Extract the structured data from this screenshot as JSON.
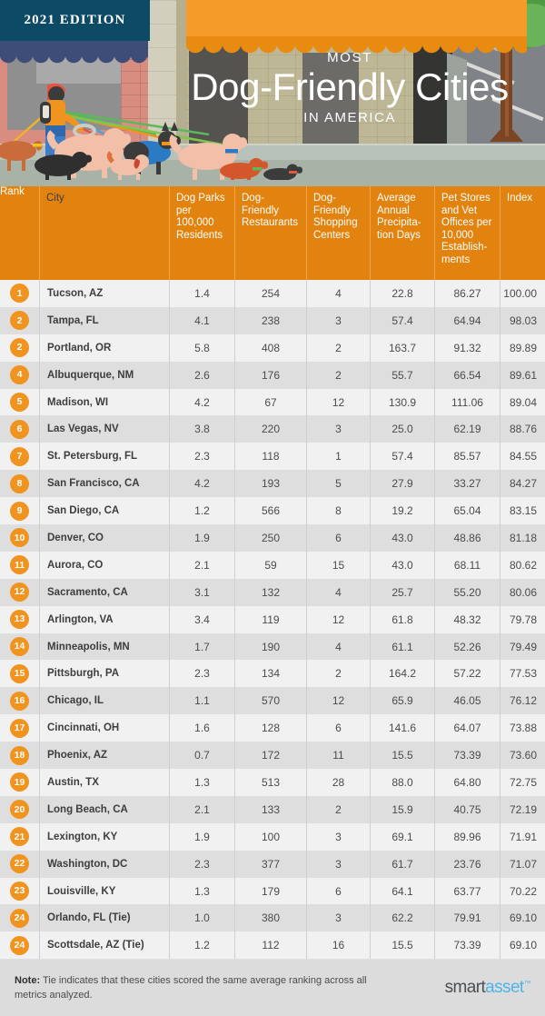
{
  "hero": {
    "edition_badge": "2021 EDITION",
    "superhead": "MOST",
    "title": "Dog-Friendly Cities",
    "subhead": "IN AMERICA",
    "illustration": "dog-walker-with-dogs-on-city-street"
  },
  "colors": {
    "header_orange": "#e2830f",
    "badge_orange": "#f0931f",
    "awning_orange": "#f59b28",
    "edition_navy": "#0d4a66",
    "row_odd": "#f1f1f1",
    "row_even": "#dedede",
    "footer_gray": "#dcdcdc",
    "logo_blue": "#4fb4e8",
    "text_gray": "#4b4b4b"
  },
  "table": {
    "columns": [
      "Rank",
      "City",
      "Dog Parks per 100,000 Residents",
      "Dog-Friendly Restaurants",
      "Dog-Friendly Shopping Centers",
      "Average Annual Precipita-tion Days",
      "Pet Stores and Vet Offices per 10,000 Establish-ments",
      "Index"
    ],
    "rows": [
      {
        "rank": "1",
        "city": "Tucson, AZ",
        "parks": "1.4",
        "restaurants": "254",
        "shopping": "4",
        "precip": "22.8",
        "pet_stores": "86.27",
        "index": "100.00"
      },
      {
        "rank": "2",
        "city": "Tampa, FL",
        "parks": "4.1",
        "restaurants": "238",
        "shopping": "3",
        "precip": "57.4",
        "pet_stores": "64.94",
        "index": "98.03"
      },
      {
        "rank": "2",
        "city": "Portland, OR",
        "parks": "5.8",
        "restaurants": "408",
        "shopping": "2",
        "precip": "163.7",
        "pet_stores": "91.32",
        "index": "89.89"
      },
      {
        "rank": "4",
        "city": "Albuquerque, NM",
        "parks": "2.6",
        "restaurants": "176",
        "shopping": "2",
        "precip": "55.7",
        "pet_stores": "66.54",
        "index": "89.61"
      },
      {
        "rank": "5",
        "city": "Madison, WI",
        "parks": "4.2",
        "restaurants": "67",
        "shopping": "12",
        "precip": "130.9",
        "pet_stores": "111.06",
        "index": "89.04"
      },
      {
        "rank": "6",
        "city": "Las Vegas, NV",
        "parks": "3.8",
        "restaurants": "220",
        "shopping": "3",
        "precip": "25.0",
        "pet_stores": "62.19",
        "index": "88.76"
      },
      {
        "rank": "7",
        "city": "St. Petersburg, FL",
        "parks": "2.3",
        "restaurants": "118",
        "shopping": "1",
        "precip": "57.4",
        "pet_stores": "85.57",
        "index": "84.55"
      },
      {
        "rank": "8",
        "city": "San Francisco, CA",
        "parks": "4.2",
        "restaurants": "193",
        "shopping": "5",
        "precip": "27.9",
        "pet_stores": "33.27",
        "index": "84.27"
      },
      {
        "rank": "9",
        "city": "San Diego, CA",
        "parks": "1.2",
        "restaurants": "566",
        "shopping": "8",
        "precip": "19.2",
        "pet_stores": "65.04",
        "index": "83.15"
      },
      {
        "rank": "10",
        "city": "Denver, CO",
        "parks": "1.9",
        "restaurants": "250",
        "shopping": "6",
        "precip": "43.0",
        "pet_stores": "48.86",
        "index": "81.18"
      },
      {
        "rank": "11",
        "city": "Aurora, CO",
        "parks": "2.1",
        "restaurants": "59",
        "shopping": "15",
        "precip": "43.0",
        "pet_stores": "68.11",
        "index": "80.62"
      },
      {
        "rank": "12",
        "city": "Sacramento, CA",
        "parks": "3.1",
        "restaurants": "132",
        "shopping": "4",
        "precip": "25.7",
        "pet_stores": "55.20",
        "index": "80.06"
      },
      {
        "rank": "13",
        "city": "Arlington, VA",
        "parks": "3.4",
        "restaurants": "119",
        "shopping": "12",
        "precip": "61.8",
        "pet_stores": "48.32",
        "index": "79.78"
      },
      {
        "rank": "14",
        "city": "Minneapolis, MN",
        "parks": "1.7",
        "restaurants": "190",
        "shopping": "4",
        "precip": "61.1",
        "pet_stores": "52.26",
        "index": "79.49"
      },
      {
        "rank": "15",
        "city": "Pittsburgh, PA",
        "parks": "2.3",
        "restaurants": "134",
        "shopping": "2",
        "precip": "164.2",
        "pet_stores": "57.22",
        "index": "77.53"
      },
      {
        "rank": "16",
        "city": "Chicago, IL",
        "parks": "1.1",
        "restaurants": "570",
        "shopping": "12",
        "precip": "65.9",
        "pet_stores": "46.05",
        "index": "76.12"
      },
      {
        "rank": "17",
        "city": "Cincinnati, OH",
        "parks": "1.6",
        "restaurants": "128",
        "shopping": "6",
        "precip": "141.6",
        "pet_stores": "64.07",
        "index": "73.88"
      },
      {
        "rank": "18",
        "city": "Phoenix, AZ",
        "parks": "0.7",
        "restaurants": "172",
        "shopping": "11",
        "precip": "15.5",
        "pet_stores": "73.39",
        "index": "73.60"
      },
      {
        "rank": "19",
        "city": "Austin, TX",
        "parks": "1.3",
        "restaurants": "513",
        "shopping": "28",
        "precip": "88.0",
        "pet_stores": "64.80",
        "index": "72.75"
      },
      {
        "rank": "20",
        "city": "Long Beach, CA",
        "parks": "2.1",
        "restaurants": "133",
        "shopping": "2",
        "precip": "15.9",
        "pet_stores": "40.75",
        "index": "72.19"
      },
      {
        "rank": "21",
        "city": "Lexington, KY",
        "parks": "1.9",
        "restaurants": "100",
        "shopping": "3",
        "precip": "69.1",
        "pet_stores": "89.96",
        "index": "71.91"
      },
      {
        "rank": "22",
        "city": "Washington, DC",
        "parks": "2.3",
        "restaurants": "377",
        "shopping": "3",
        "precip": "61.7",
        "pet_stores": "23.76",
        "index": "71.07"
      },
      {
        "rank": "23",
        "city": "Louisville, KY",
        "parks": "1.3",
        "restaurants": "179",
        "shopping": "6",
        "precip": "64.1",
        "pet_stores": "63.77",
        "index": "70.22"
      },
      {
        "rank": "24",
        "city": "Orlando, FL (Tie)",
        "parks": "1.0",
        "restaurants": "380",
        "shopping": "3",
        "precip": "62.2",
        "pet_stores": "79.91",
        "index": "69.10"
      },
      {
        "rank": "24",
        "city": "Scottsdale, AZ (Tie)",
        "parks": "1.2",
        "restaurants": "112",
        "shopping": "16",
        "precip": "15.5",
        "pet_stores": "73.39",
        "index": "69.10"
      }
    ]
  },
  "footer": {
    "note_label": "Note:",
    "note_text": " Tie indicates that these cities scored the same average ranking across all metrics analyzed.",
    "logo_first": "smart",
    "logo_second": "asset",
    "logo_tm": "™"
  },
  "chart_data": {
    "type": "table",
    "title": "Most Dog-Friendly Cities in America",
    "columns": [
      "Rank",
      "City",
      "Dog Parks per 100,000 Residents",
      "Dog-Friendly Restaurants",
      "Dog-Friendly Shopping Centers",
      "Average Annual Precipitation Days",
      "Pet Stores and Vet Offices per 10,000 Establishments",
      "Index"
    ],
    "rows": [
      [
        "1",
        "Tucson, AZ",
        1.4,
        254,
        4,
        22.8,
        86.27,
        100.0
      ],
      [
        "2",
        "Tampa, FL",
        4.1,
        238,
        3,
        57.4,
        64.94,
        98.03
      ],
      [
        "2",
        "Portland, OR",
        5.8,
        408,
        2,
        163.7,
        91.32,
        89.89
      ],
      [
        "4",
        "Albuquerque, NM",
        2.6,
        176,
        2,
        55.7,
        66.54,
        89.61
      ],
      [
        "5",
        "Madison, WI",
        4.2,
        67,
        12,
        130.9,
        111.06,
        89.04
      ],
      [
        "6",
        "Las Vegas, NV",
        3.8,
        220,
        3,
        25.0,
        62.19,
        88.76
      ],
      [
        "7",
        "St. Petersburg, FL",
        2.3,
        118,
        1,
        57.4,
        85.57,
        84.55
      ],
      [
        "8",
        "San Francisco, CA",
        4.2,
        193,
        5,
        27.9,
        33.27,
        84.27
      ],
      [
        "9",
        "San Diego, CA",
        1.2,
        566,
        8,
        19.2,
        65.04,
        83.15
      ],
      [
        "10",
        "Denver, CO",
        1.9,
        250,
        6,
        43.0,
        48.86,
        81.18
      ],
      [
        "11",
        "Aurora, CO",
        2.1,
        59,
        15,
        43.0,
        68.11,
        80.62
      ],
      [
        "12",
        "Sacramento, CA",
        3.1,
        132,
        4,
        25.7,
        55.2,
        80.06
      ],
      [
        "13",
        "Arlington, VA",
        3.4,
        119,
        12,
        61.8,
        48.32,
        79.78
      ],
      [
        "14",
        "Minneapolis, MN",
        1.7,
        190,
        4,
        61.1,
        52.26,
        79.49
      ],
      [
        "15",
        "Pittsburgh, PA",
        2.3,
        134,
        2,
        164.2,
        57.22,
        77.53
      ],
      [
        "16",
        "Chicago, IL",
        1.1,
        570,
        12,
        65.9,
        46.05,
        76.12
      ],
      [
        "17",
        "Cincinnati, OH",
        1.6,
        128,
        6,
        141.6,
        64.07,
        73.88
      ],
      [
        "18",
        "Phoenix, AZ",
        0.7,
        172,
        11,
        15.5,
        73.39,
        73.6
      ],
      [
        "19",
        "Austin, TX",
        1.3,
        513,
        28,
        88.0,
        64.8,
        72.75
      ],
      [
        "20",
        "Long Beach, CA",
        2.1,
        133,
        2,
        15.9,
        40.75,
        72.19
      ],
      [
        "21",
        "Lexington, KY",
        1.9,
        100,
        3,
        69.1,
        89.96,
        71.91
      ],
      [
        "22",
        "Washington, DC",
        2.3,
        377,
        3,
        61.7,
        23.76,
        71.07
      ],
      [
        "23",
        "Louisville, KY",
        1.3,
        179,
        6,
        64.1,
        63.77,
        70.22
      ],
      [
        "24",
        "Orlando, FL (Tie)",
        1.0,
        380,
        3,
        62.2,
        79.91,
        69.1
      ],
      [
        "24",
        "Scottsdale, AZ (Tie)",
        1.2,
        112,
        16,
        15.5,
        73.39,
        69.1
      ]
    ]
  }
}
